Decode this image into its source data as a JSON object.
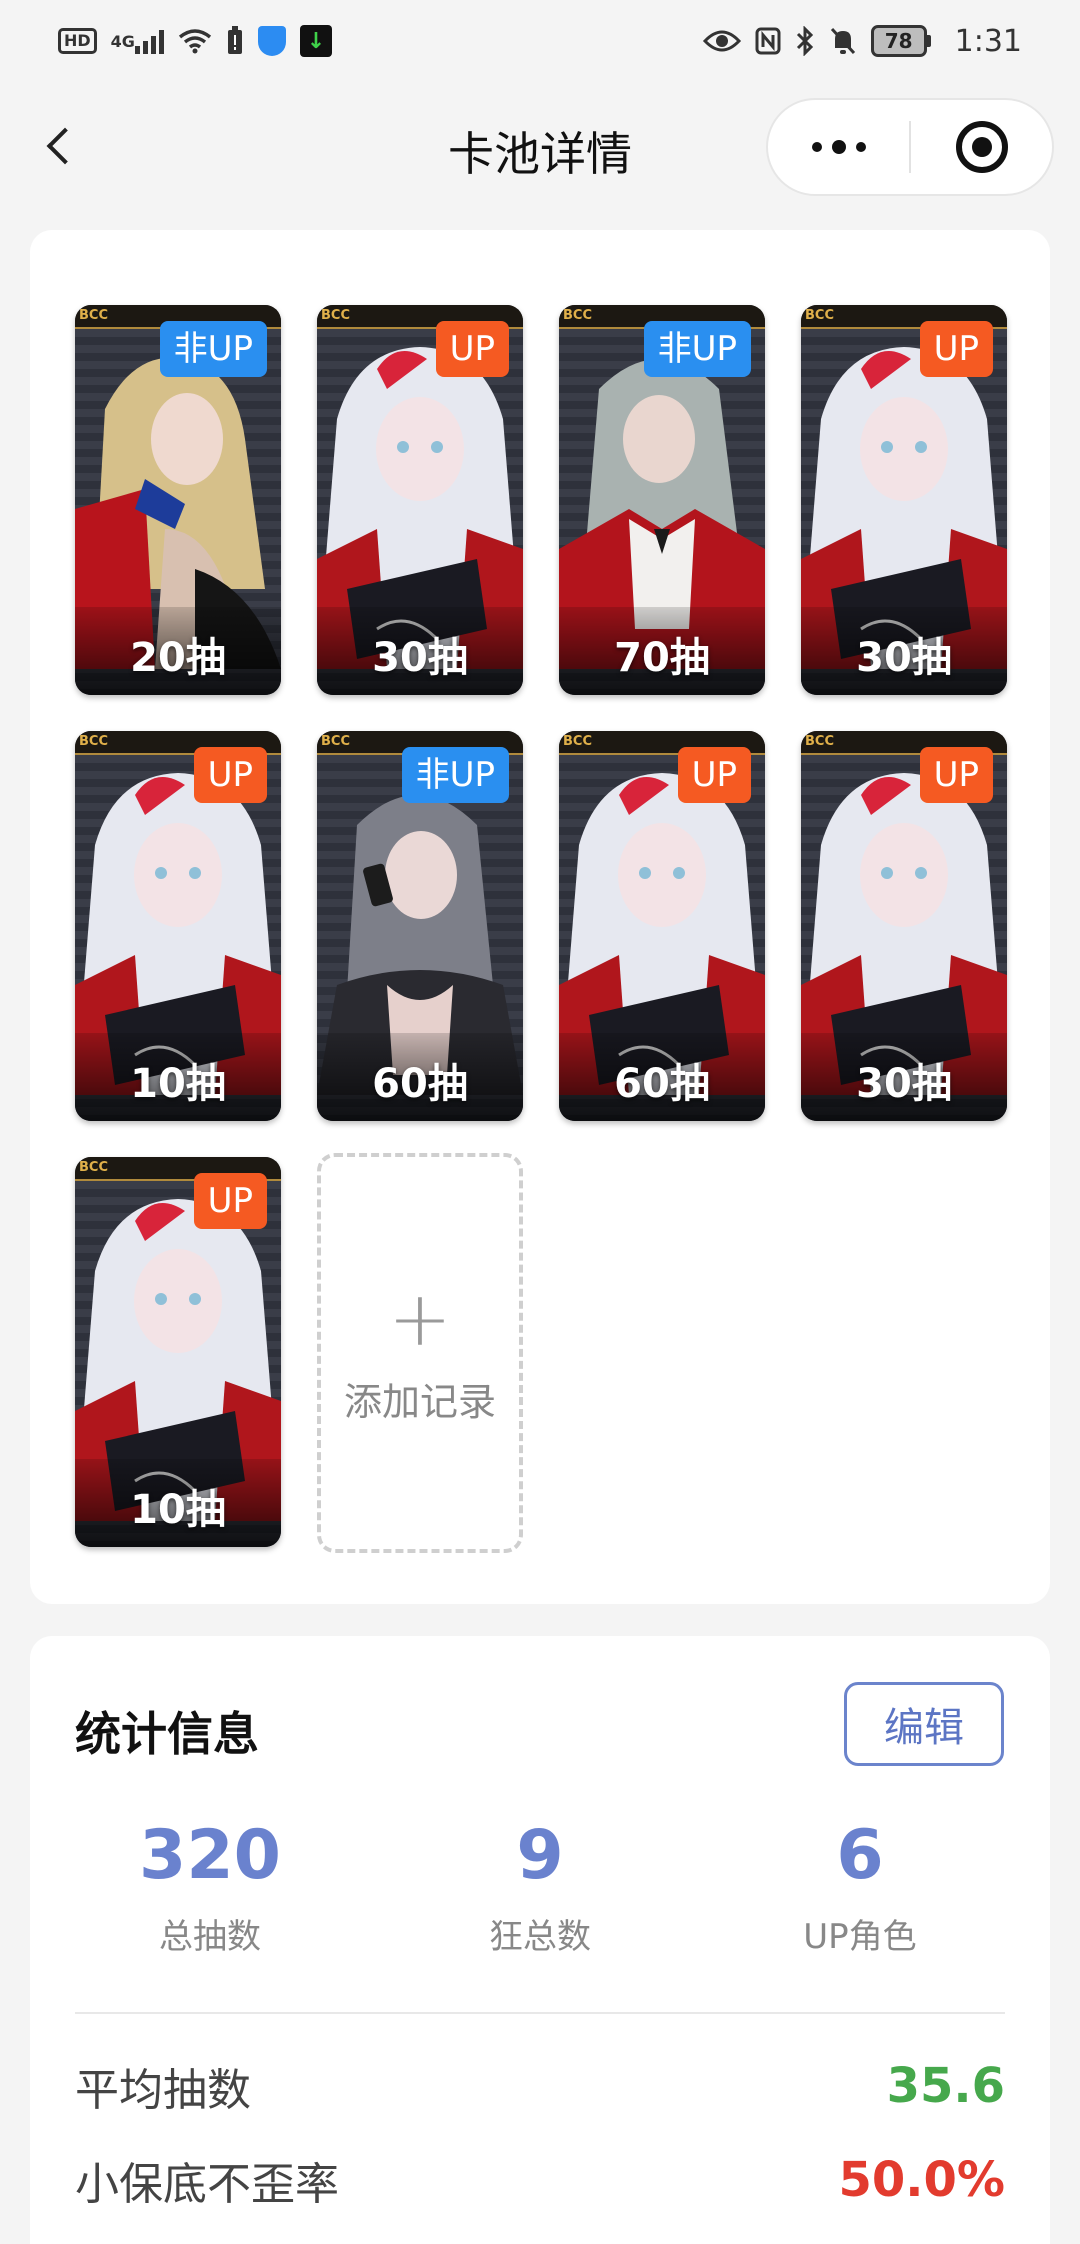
{
  "status_bar": {
    "hd": "HD",
    "network": "4G",
    "battery": "78",
    "time": "1:31"
  },
  "nav": {
    "title": "卡池详情"
  },
  "records": {
    "cards": [
      {
        "badge": "非UP",
        "badge_type": "nonup",
        "draws": "20抽",
        "character": "blonde"
      },
      {
        "badge": "UP",
        "badge_type": "up",
        "draws": "30抽",
        "character": "white-hair"
      },
      {
        "badge": "非UP",
        "badge_type": "nonup",
        "draws": "70抽",
        "character": "silver-hair"
      },
      {
        "badge": "UP",
        "badge_type": "up",
        "draws": "30抽",
        "character": "white-hair"
      },
      {
        "badge": "UP",
        "badge_type": "up",
        "draws": "10抽",
        "character": "white-hair"
      },
      {
        "badge": "非UP",
        "badge_type": "nonup",
        "draws": "60抽",
        "character": "grey-hair-phone"
      },
      {
        "badge": "UP",
        "badge_type": "up",
        "draws": "60抽",
        "character": "white-hair"
      },
      {
        "badge": "UP",
        "badge_type": "up",
        "draws": "30抽",
        "character": "white-hair"
      },
      {
        "badge": "UP",
        "badge_type": "up",
        "draws": "10抽",
        "character": "white-hair"
      }
    ],
    "add_plus": "+",
    "add_label": "添加记录"
  },
  "stats": {
    "title": "统计信息",
    "edit_label": "编辑",
    "metrics": [
      {
        "value": "320",
        "label": "总抽数"
      },
      {
        "value": "9",
        "label": "狂总数"
      },
      {
        "value": "6",
        "label": "UP角色"
      }
    ],
    "rows": [
      {
        "key": "平均抽数",
        "value": "35.6",
        "tone": "green"
      },
      {
        "key": "小保底不歪率",
        "value": "50.0%",
        "tone": "red"
      }
    ]
  },
  "colors": {
    "up_badge": "#f55a22",
    "nonup_badge": "#2a8ff0",
    "metric_blue": "#6a82ce",
    "avg_green": "#46a84c",
    "rate_red": "#e23b2e"
  }
}
